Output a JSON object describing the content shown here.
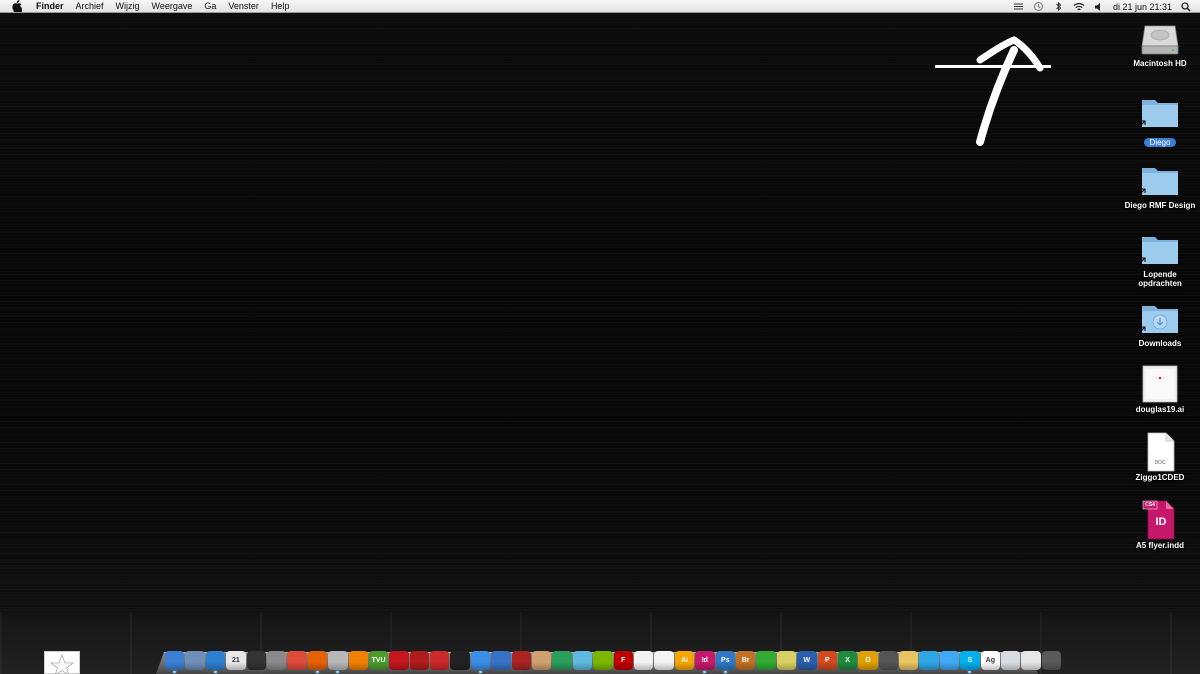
{
  "menubar": {
    "apple_icon": "apple-icon",
    "app_name": "Finder",
    "items": [
      "Archief",
      "Wijzig",
      "Weergave",
      "Ga",
      "Venster",
      "Help"
    ],
    "status_icons": [
      "dropbox-icon",
      "time-machine-icon",
      "bluetooth-icon",
      "wifi-icon",
      "volume-icon"
    ],
    "clock": "di 21 jun  21:31",
    "search_icon": "spotlight-search-icon"
  },
  "desktop_icons": [
    {
      "name": "Macintosh HD",
      "kind": "hard-drive-icon",
      "selected": false
    },
    {
      "name": "Diego",
      "kind": "folder-alias-icon",
      "selected": true
    },
    {
      "name": "Diego RMF Design",
      "kind": "folder-alias-icon",
      "selected": false
    },
    {
      "name": "Lopende opdrachten",
      "kind": "folder-alias-icon",
      "selected": false
    },
    {
      "name": "Downloads",
      "kind": "downloads-folder-alias-icon",
      "selected": false
    },
    {
      "name": "douglas19.ai",
      "kind": "illustrator-file-icon",
      "selected": false
    },
    {
      "name": "Ziggo1CDED",
      "kind": "doc-file-icon",
      "selected": false
    },
    {
      "name": "A5 flyer.indd",
      "kind": "indesign-file-icon",
      "selected": false
    }
  ],
  "doc_file_badge": "DOC",
  "indd_badge": "CS4",
  "indd_glyph": "ID",
  "dock": {
    "items": [
      {
        "name": "finder",
        "color": "#3b7fd4",
        "glyph": "",
        "running": true
      },
      {
        "name": "preview",
        "color": "#6f8fb8",
        "glyph": "",
        "running": false
      },
      {
        "name": "safari",
        "color": "#2d7fd0",
        "glyph": "",
        "running": true
      },
      {
        "name": "ical",
        "color": "#e8e8e8",
        "glyph": "21",
        "running": false
      },
      {
        "name": "dashboard",
        "color": "#333333",
        "glyph": "",
        "running": false
      },
      {
        "name": "system-preferences",
        "color": "#8a8a8a",
        "glyph": "",
        "running": false
      },
      {
        "name": "chrome",
        "color": "#dd4b39",
        "glyph": "",
        "running": false
      },
      {
        "name": "firefox",
        "color": "#e66000",
        "glyph": "",
        "running": true
      },
      {
        "name": "address-book",
        "color": "#b8b8b8",
        "glyph": "",
        "running": true
      },
      {
        "name": "vlc",
        "color": "#f08000",
        "glyph": "",
        "running": false
      },
      {
        "name": "tvu",
        "color": "#4a9c2d",
        "glyph": "TVU",
        "running": false
      },
      {
        "name": "adobe-acrobat",
        "color": "#c4161c",
        "glyph": "",
        "running": false
      },
      {
        "name": "photo-booth",
        "color": "#b01c1c",
        "glyph": "",
        "running": false
      },
      {
        "name": "textmate",
        "color": "#cc2a2a",
        "glyph": "",
        "running": false
      },
      {
        "name": "inkscape",
        "color": "#222222",
        "glyph": "",
        "running": false
      },
      {
        "name": "itunes",
        "color": "#3a8ee6",
        "glyph": "",
        "running": true
      },
      {
        "name": "quicktime",
        "color": "#3673c6",
        "glyph": "",
        "running": false
      },
      {
        "name": "sketch-tool",
        "color": "#aa2222",
        "glyph": "",
        "running": false
      },
      {
        "name": "transmission",
        "color": "#d0a070",
        "glyph": "",
        "running": false
      },
      {
        "name": "camino",
        "color": "#2a9e5a",
        "glyph": "",
        "running": false
      },
      {
        "name": "network-utility",
        "color": "#5fb9e0",
        "glyph": "",
        "running": false
      },
      {
        "name": "spotify",
        "color": "#7ab800",
        "glyph": "",
        "running": false
      },
      {
        "name": "filezilla",
        "color": "#bf0000",
        "glyph": "F",
        "running": false
      },
      {
        "name": "textedit",
        "color": "#f2f2f2",
        "glyph": "",
        "running": false
      },
      {
        "name": "acrobat-reader",
        "color": "#f4f4f4",
        "glyph": "",
        "running": false
      },
      {
        "name": "adobe-illustrator",
        "color": "#f7a500",
        "glyph": "Ai",
        "running": false
      },
      {
        "name": "adobe-indesign",
        "color": "#c5186a",
        "glyph": "Id",
        "running": true
      },
      {
        "name": "adobe-photoshop",
        "color": "#2f78c4",
        "glyph": "Ps",
        "running": true
      },
      {
        "name": "adobe-bridge",
        "color": "#c27021",
        "glyph": "Br",
        "running": false
      },
      {
        "name": "skitch",
        "color": "#33aa33",
        "glyph": "",
        "running": false
      },
      {
        "name": "stickies",
        "color": "#d8d060",
        "glyph": "",
        "running": false
      },
      {
        "name": "word",
        "color": "#2a5fb0",
        "glyph": "W",
        "running": false
      },
      {
        "name": "powerpoint",
        "color": "#d24a1d",
        "glyph": "P",
        "running": false
      },
      {
        "name": "excel",
        "color": "#1e8a3c",
        "glyph": "X",
        "running": false
      },
      {
        "name": "outlook",
        "color": "#e0a000",
        "glyph": "O",
        "running": false
      },
      {
        "name": "screenshot",
        "color": "#555555",
        "glyph": "",
        "running": false
      },
      {
        "name": "mail",
        "color": "#e8c560",
        "glyph": "",
        "running": false
      },
      {
        "name": "twitter",
        "color": "#2ea6e6",
        "glyph": "",
        "running": false
      },
      {
        "name": "messenger",
        "color": "#3fa9f5",
        "glyph": "",
        "running": false
      },
      {
        "name": "skype",
        "color": "#00aff0",
        "glyph": "S",
        "running": true
      },
      {
        "name": "font-book",
        "color": "#ffffff",
        "glyph": "Ag",
        "running": false
      },
      {
        "name": "documents-stack",
        "color": "#d9dde3",
        "glyph": "",
        "running": false
      },
      {
        "name": "downloads-stack",
        "color": "#e6e6e6",
        "glyph": "",
        "running": false
      },
      {
        "name": "trash",
        "color": "#5a5a5a",
        "glyph": "",
        "running": false
      }
    ]
  },
  "colors": {
    "accent": "#3d7fd6",
    "folder": "#8ec1e8",
    "indesign": "#c5186a"
  }
}
